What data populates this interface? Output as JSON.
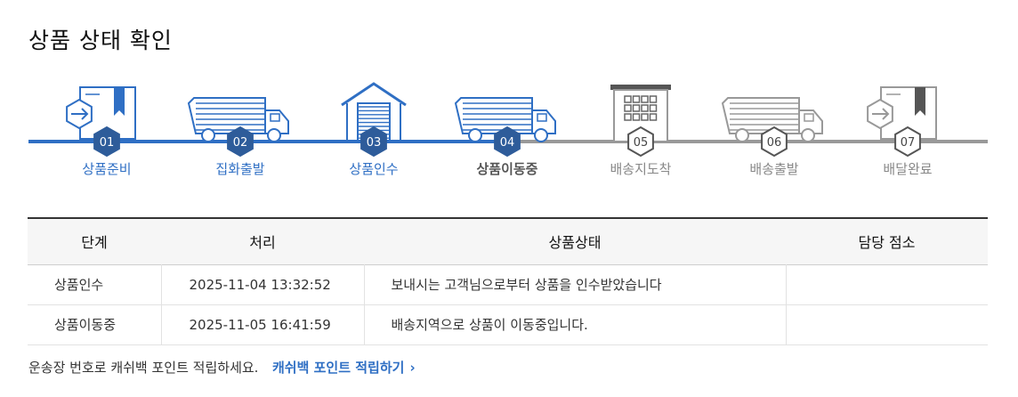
{
  "page": {
    "title": "상품 상태 확인"
  },
  "tracker": {
    "current_step": 4,
    "steps": [
      {
        "num": "01",
        "label": "상품준비",
        "icon": "package-arrow-icon"
      },
      {
        "num": "02",
        "label": "집화출발",
        "icon": "truck-icon"
      },
      {
        "num": "03",
        "label": "상품인수",
        "icon": "warehouse-icon"
      },
      {
        "num": "04",
        "label": "상품이동중",
        "icon": "truck-icon"
      },
      {
        "num": "05",
        "label": "배송지도착",
        "icon": "building-icon"
      },
      {
        "num": "06",
        "label": "배송출발",
        "icon": "truck-icon"
      },
      {
        "num": "07",
        "label": "배달완료",
        "icon": "package-arrow-icon"
      }
    ],
    "colors": {
      "done": "#2f6fc4",
      "pending": "#999999",
      "badge_done": "#2e5c9a"
    }
  },
  "table": {
    "headers": [
      "단계",
      "처리",
      "상품상태",
      "담당 점소"
    ],
    "rows": [
      {
        "step": "상품인수",
        "time": "2025-11-04 13:32:52",
        "status": "보내시는 고객님으로부터 상품을 인수받았습니다",
        "office": ""
      },
      {
        "step": "상품이동중",
        "time": "2025-11-05 16:41:59",
        "status": "배송지역으로 상품이 이동중입니다.",
        "office": ""
      }
    ]
  },
  "footer": {
    "note": "운송장 번호로 캐쉬백 포인트 적립하세요.",
    "link": "캐쉬백 포인트 적립하기",
    "link_arrow": "›"
  }
}
